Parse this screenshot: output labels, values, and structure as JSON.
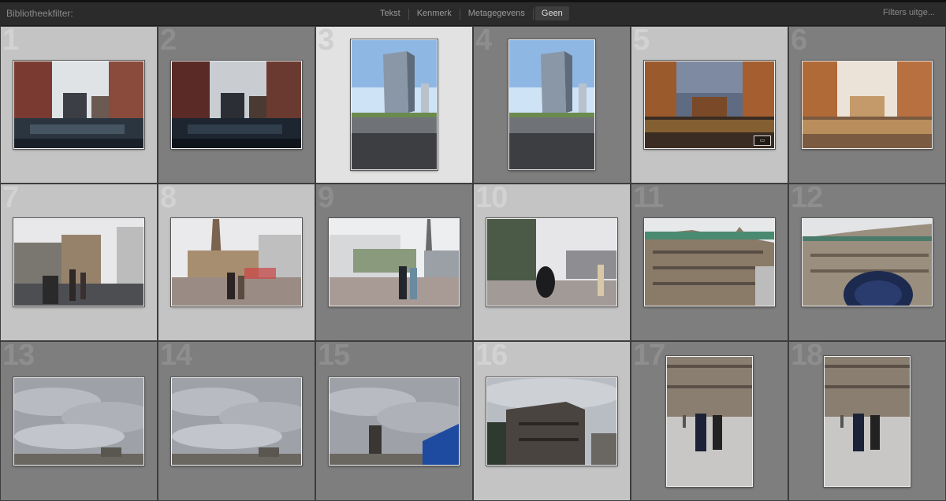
{
  "filterbar": {
    "title": "Bibliotheekfilter:",
    "tabs": [
      "Tekst",
      "Kenmerk",
      "Metagegevens",
      "Geen"
    ],
    "active_tab": "Geen",
    "right_label": "Filters uitge..."
  },
  "grid": {
    "cells": [
      {
        "number": "1",
        "shade": "light",
        "orient": "land",
        "scene": "canal"
      },
      {
        "number": "2",
        "shade": "dark",
        "orient": "land",
        "scene": "canal-dark"
      },
      {
        "number": "3",
        "shade": "sel",
        "orient": "port",
        "scene": "tower"
      },
      {
        "number": "4",
        "shade": "dark",
        "orient": "port",
        "scene": "tower"
      },
      {
        "number": "5",
        "shade": "light",
        "orient": "land",
        "scene": "golden-canal"
      },
      {
        "number": "6",
        "shade": "dark",
        "orient": "land",
        "scene": "golden-canal-light"
      },
      {
        "number": "7",
        "shade": "light",
        "orient": "land",
        "scene": "street"
      },
      {
        "number": "8",
        "shade": "light",
        "orient": "land",
        "scene": "square"
      },
      {
        "number": "9",
        "shade": "dark",
        "orient": "land",
        "scene": "plaza"
      },
      {
        "number": "10",
        "shade": "light",
        "orient": "land",
        "scene": "walkers"
      },
      {
        "number": "11",
        "shade": "dark",
        "orient": "land",
        "scene": "cityhall"
      },
      {
        "number": "12",
        "shade": "dark",
        "orient": "land",
        "scene": "cityhall-umbrella"
      },
      {
        "number": "13",
        "shade": "dark",
        "orient": "land",
        "scene": "sky"
      },
      {
        "number": "14",
        "shade": "dark",
        "orient": "land",
        "scene": "sky"
      },
      {
        "number": "15",
        "shade": "dark",
        "orient": "land",
        "scene": "sky-tower"
      },
      {
        "number": "16",
        "shade": "light",
        "orient": "land",
        "scene": "building"
      },
      {
        "number": "17",
        "shade": "dark",
        "orient": "port",
        "scene": "pedestrians"
      },
      {
        "number": "18",
        "shade": "dark",
        "orient": "port",
        "scene": "pedestrians"
      }
    ]
  },
  "colors": {
    "cell_dark": "#7e7e7e",
    "cell_light": "#c4c4c4",
    "cell_selected": "#e2e2e2"
  }
}
